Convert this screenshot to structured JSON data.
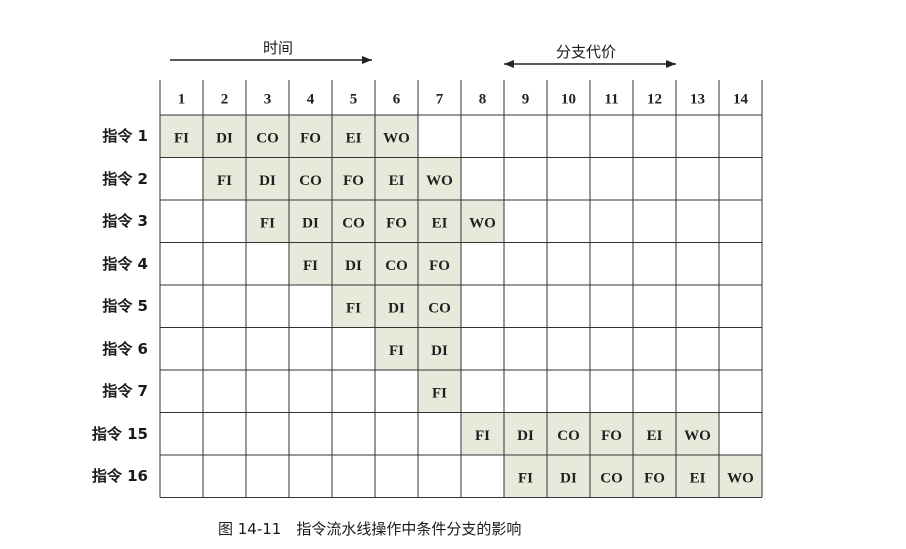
{
  "diagram": {
    "time_label": "时间",
    "branch_cost_label": "分支代价",
    "caption": "图 14-11　指令流水线操作中条件分支的影响",
    "cycles": [
      "1",
      "2",
      "3",
      "4",
      "5",
      "6",
      "7",
      "8",
      "9",
      "10",
      "11",
      "12",
      "13",
      "14"
    ],
    "highlight_color": "#e6eadb",
    "rows": [
      {
        "label": "指令 1",
        "start": 1,
        "stages": [
          "FI",
          "DI",
          "CO",
          "FO",
          "EI",
          "WO"
        ]
      },
      {
        "label": "指令 2",
        "start": 2,
        "stages": [
          "FI",
          "DI",
          "CO",
          "FO",
          "EI",
          "WO"
        ]
      },
      {
        "label": "指令 3",
        "start": 3,
        "stages": [
          "FI",
          "DI",
          "CO",
          "FO",
          "EI",
          "WO"
        ]
      },
      {
        "label": "指令 4",
        "start": 4,
        "stages": [
          "FI",
          "DI",
          "CO",
          "FO"
        ]
      },
      {
        "label": "指令 5",
        "start": 5,
        "stages": [
          "FI",
          "DI",
          "CO"
        ]
      },
      {
        "label": "指令 6",
        "start": 6,
        "stages": [
          "FI",
          "DI"
        ]
      },
      {
        "label": "指令 7",
        "start": 7,
        "stages": [
          "FI"
        ]
      },
      {
        "label": "指令 15",
        "start": 8,
        "stages": [
          "FI",
          "DI",
          "CO",
          "FO",
          "EI",
          "WO"
        ]
      },
      {
        "label": "指令 16",
        "start": 9,
        "stages": [
          "FI",
          "DI",
          "CO",
          "FO",
          "EI",
          "WO"
        ]
      }
    ]
  }
}
